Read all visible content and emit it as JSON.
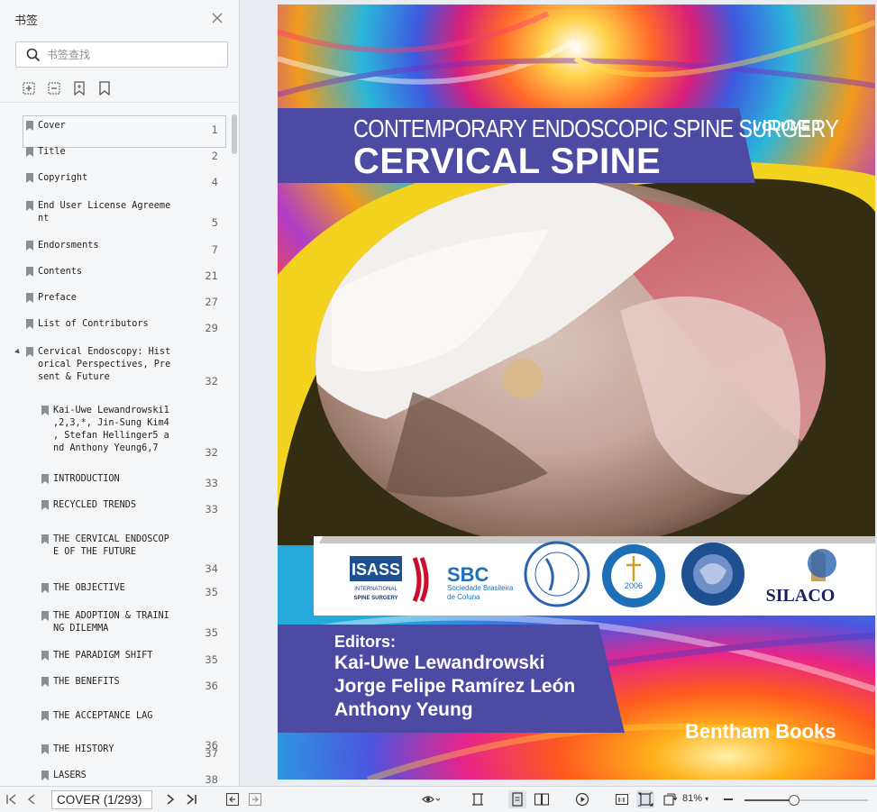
{
  "sidebar": {
    "title": "书签",
    "search_placeholder": "书签查找",
    "bookmarks": [
      {
        "label": "Cover",
        "page": "1"
      },
      {
        "label": "Title",
        "page": "2"
      },
      {
        "label": "Copyright",
        "page": "4"
      },
      {
        "label": "End User License Agreeme\nnt",
        "page": "5"
      },
      {
        "label": "Endorsments",
        "page": "7"
      },
      {
        "label": "Contents",
        "page": "21"
      },
      {
        "label": "Preface",
        "page": "27"
      },
      {
        "label": "List of Contributors",
        "page": "29"
      },
      {
        "label": "Cervical Endoscopy: Hist\norical Perspectives, Pre\nsent & Future",
        "page": "32"
      },
      {
        "label": "Kai-Uwe Lewandrowski1\n,2,3,*, Jin-Sung Kim4\n, Stefan Hellinger5 a\nnd Anthony Yeung6,7",
        "page": "32"
      },
      {
        "label": "INTRODUCTION",
        "page": "33"
      },
      {
        "label": "RECYCLED TRENDS",
        "page": "33"
      },
      {
        "label": "THE CERVICAL ENDOSCOP\nE OF THE FUTURE",
        "page": "34"
      },
      {
        "label": "THE OBJECTIVE",
        "page": "35"
      },
      {
        "label": "THE ADOPTION & TRAINI\nNG DILEMMA",
        "page": "35"
      },
      {
        "label": "THE PARADIGM SHIFT",
        "page": "35"
      },
      {
        "label": "THE BENEFITS",
        "page": "36"
      },
      {
        "label": "THE ACCEPTANCE LAG",
        "page": "36"
      },
      {
        "label": "THE HISTORY",
        "page": "37"
      },
      {
        "label": "LASERS",
        "page": "38"
      }
    ]
  },
  "cover": {
    "series": "CONTEMPORARY ENDOSCOPIC SPINE SURGERY",
    "volume": "VOLUME 1",
    "title": "CERVICAL SPINE",
    "logos": {
      "isass_big": "ISASS",
      "isass_sub": "INTERNATIONAL",
      "isass_sub2": "SPINE SURGERY",
      "sbc": "SBC",
      "sbc_sub1": "Sociedade Brasileira",
      "sbc_sub2": "de Coluna",
      "seccmi_num": "2006",
      "silaco": "SILACO"
    },
    "editors_label": "Editors:",
    "editors": [
      "Kai-Uwe Lewandrowski",
      "Jorge Felipe Ramírez León",
      "Anthony Yeung"
    ],
    "publisher": "Bentham Books"
  },
  "statusbar": {
    "page_field": "COVER (1/293)",
    "zoom": "81%",
    "zoom_fraction": 0.4
  },
  "colors": {
    "banner": "#4c4aa3",
    "yellow": "#f3d31f",
    "accent": "#1d6fb6"
  }
}
